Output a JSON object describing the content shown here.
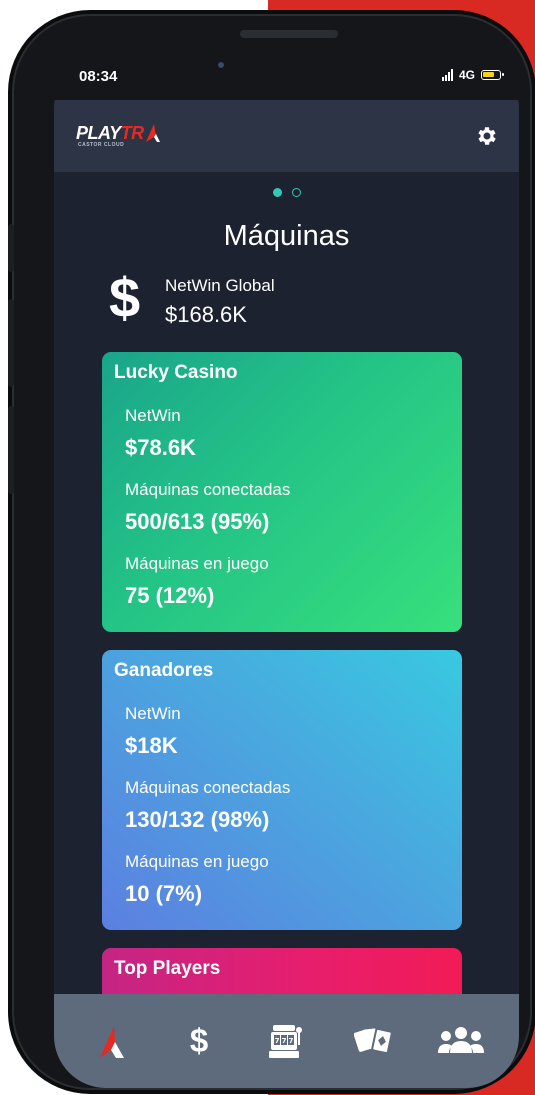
{
  "status_bar": {
    "time": "08:34",
    "network": "4G"
  },
  "app_bar": {
    "logo_text_white": "PLAY",
    "logo_text_red": "TR",
    "logo_subtext": "CASTOR CLOUD"
  },
  "carousel": {
    "total_pages": 2,
    "active_page": 1
  },
  "page_title": "Máquinas",
  "netwin_global": {
    "label": "NetWin Global",
    "value": "$168.6K",
    "icon": "dollar-icon"
  },
  "cards": [
    {
      "title": "Lucky Casino",
      "netwin_label": "NetWin",
      "netwin_value": "$78.6K",
      "connected_label": "Máquinas conectadas",
      "connected_value": "500/613 (95%)",
      "playing_label": "Máquinas en juego",
      "playing_value": "75 (12%)"
    },
    {
      "title": "Ganadores",
      "netwin_label": "NetWin",
      "netwin_value": "$18K",
      "connected_label": "Máquinas conectadas",
      "connected_value": "130/132 (98%)",
      "playing_label": "Máquinas en juego",
      "playing_value": "10 (7%)"
    },
    {
      "title": "Top Players"
    }
  ],
  "bottom_nav": {
    "items": [
      {
        "icon": "playtrak-logo-icon"
      },
      {
        "icon": "dollar-icon",
        "glyph": "$"
      },
      {
        "icon": "slot-machine-icon"
      },
      {
        "icon": "playing-cards-icon"
      },
      {
        "icon": "users-group-icon"
      }
    ]
  },
  "colors": {
    "background_red": "#d82a22",
    "screen_bg": "#1d2230",
    "app_bar_bg": "#2d3445",
    "bottom_bar_bg": "#5d6b7c",
    "accent_teal": "#35c9b4",
    "brand_red": "#e52a24"
  }
}
